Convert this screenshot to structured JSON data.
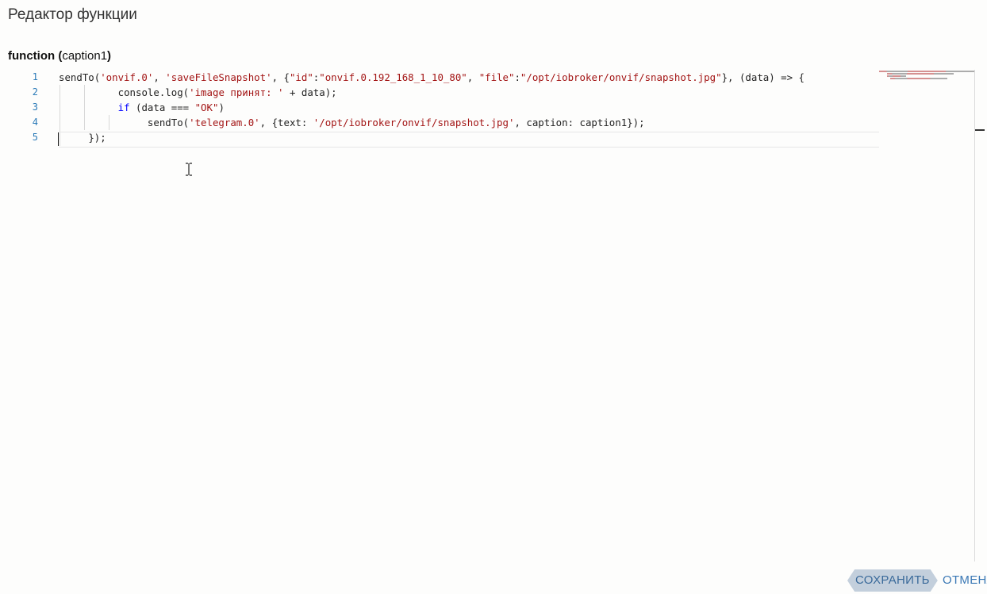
{
  "dialog": {
    "title": "Редактор функции"
  },
  "func": {
    "keyword": "function",
    "params": "caption1"
  },
  "editor": {
    "line_numbers": [
      "1",
      "2",
      "3",
      "4",
      "5"
    ],
    "lines": [
      {
        "indent": "",
        "parts": [
          {
            "t": "sendTo(",
            "c": ""
          },
          {
            "t": "'onvif.0'",
            "c": "str"
          },
          {
            "t": ", ",
            "c": ""
          },
          {
            "t": "'saveFileSnapshot'",
            "c": "str"
          },
          {
            "t": ", {",
            "c": ""
          },
          {
            "t": "\"id\"",
            "c": "str"
          },
          {
            "t": ":",
            "c": ""
          },
          {
            "t": "\"onvif.0.192_168_1_10_80\"",
            "c": "str"
          },
          {
            "t": ", ",
            "c": ""
          },
          {
            "t": "\"file\"",
            "c": "str"
          },
          {
            "t": ":",
            "c": ""
          },
          {
            "t": "\"/opt/iobroker/onvif/snapshot.jpg\"",
            "c": "str"
          },
          {
            "t": "}, (data) => {",
            "c": ""
          }
        ]
      },
      {
        "indent": "          ",
        "parts": [
          {
            "t": "console.log(",
            "c": ""
          },
          {
            "t": "'image принят: '",
            "c": "str"
          },
          {
            "t": " + data);",
            "c": ""
          }
        ]
      },
      {
        "indent": "          ",
        "parts": [
          {
            "t": "if",
            "c": "kwd"
          },
          {
            "t": " (data === ",
            "c": ""
          },
          {
            "t": "\"OK\"",
            "c": "str"
          },
          {
            "t": ")",
            "c": ""
          }
        ]
      },
      {
        "indent": "               ",
        "parts": [
          {
            "t": "sendTo(",
            "c": ""
          },
          {
            "t": "'telegram.0'",
            "c": "str"
          },
          {
            "t": ", {text: ",
            "c": ""
          },
          {
            "t": "'/opt/iobroker/onvif/snapshot.jpg'",
            "c": "str"
          },
          {
            "t": ", caption: caption1});",
            "c": ""
          }
        ]
      },
      {
        "indent": "     ",
        "parts": [
          {
            "t": "});",
            "c": ""
          }
        ]
      }
    ]
  },
  "buttons": {
    "save": "СОХРАНИТЬ",
    "cancel": "ОТМЕНА"
  },
  "colors": {
    "string": "#a31515",
    "keyword": "#0000ff",
    "line_number": "#2b7ab8",
    "button_text": "#3a78b5"
  }
}
